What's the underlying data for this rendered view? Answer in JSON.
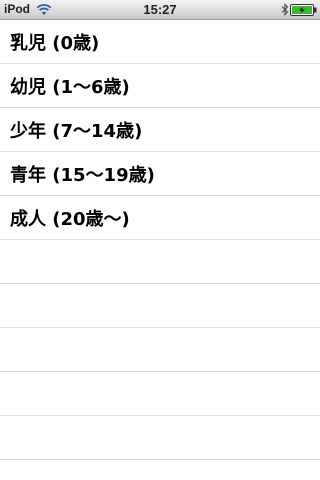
{
  "status_bar": {
    "carrier": "iPod",
    "time": "15:27",
    "icons": [
      "wifi-icon",
      "bluetooth-icon",
      "battery-charging-icon"
    ]
  },
  "list": {
    "items": [
      {
        "label": "乳児 (0歳)"
      },
      {
        "label": "幼児 (1〜6歳)"
      },
      {
        "label": "少年 (7〜14歳)"
      },
      {
        "label": "青年 (15〜19歳)"
      },
      {
        "label": "成人 (20歳〜)"
      }
    ]
  },
  "colors": {
    "separator": "#e0e0e0",
    "battery_charge": "#3dbb2f"
  }
}
